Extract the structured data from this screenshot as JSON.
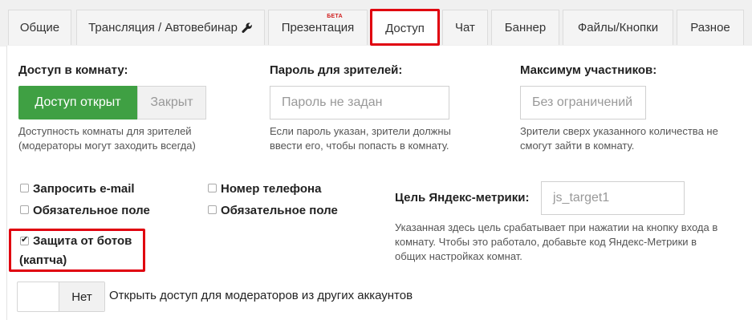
{
  "tabs": [
    {
      "label": "Общие"
    },
    {
      "label": "Трансляция / Автовебинар"
    },
    {
      "label": "Презентация",
      "badge": "БЕТА"
    },
    {
      "label": "Доступ"
    },
    {
      "label": "Чат"
    },
    {
      "label": "Баннер"
    },
    {
      "label": "Файлы/Кнопки"
    },
    {
      "label": "Разное"
    }
  ],
  "access": {
    "heading": "Доступ в комнату:",
    "open_label": "Доступ открыт",
    "closed_label": "Закрыт",
    "description_1": "Доступность комнаты для зрителей",
    "description_2": "(модераторы могут заходить всегда)"
  },
  "password": {
    "heading": "Пароль для зрителей:",
    "placeholder": "Пароль не задан",
    "description_1": "Если пароль указан, зрители должны",
    "description_2": "ввести его, чтобы попасть в комнату."
  },
  "max_participants": {
    "heading": "Максимум участников:",
    "placeholder": "Без ограничений",
    "description_1": "Зрители сверх указанного количества не",
    "description_2": "смогут зайти в комнату."
  },
  "checkboxes": {
    "request_email": "Запросить e-mail",
    "email_required": "Обязательное поле",
    "phone": "Номер телефона",
    "phone_required": "Обязательное поле",
    "captcha_line1": "Защита от ботов",
    "captcha_line2": "(каптча)"
  },
  "yandex": {
    "label": "Цель Яндекс-метрики:",
    "value": "js_target1",
    "description_1": "Указанная здесь цель срабатывает при нажатии на кнопку входа в",
    "description_2": "комнату. Чтобы это работало, добавьте код Яндекс-Метрики в",
    "description_3": "общих настройках комнат."
  },
  "moderators": {
    "toggle_label": "Нет",
    "text": "Открыть доступ для модераторов из других аккаунтов"
  },
  "colors": {
    "accent_green": "#3fa043",
    "highlight_red": "#e0000f"
  }
}
